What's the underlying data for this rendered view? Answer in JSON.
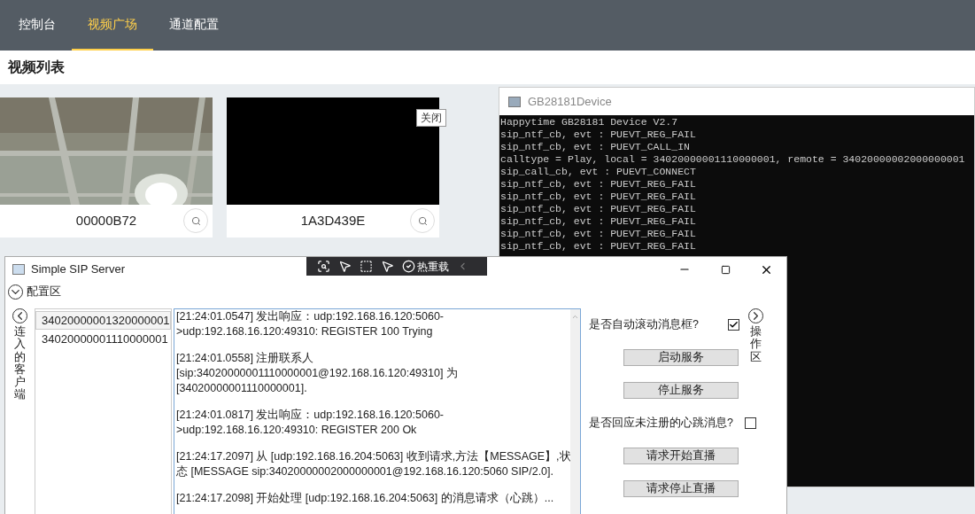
{
  "web_page": {
    "tabs": [
      {
        "label": "控制台",
        "selected": false
      },
      {
        "label": "视频广场",
        "selected": true
      },
      {
        "label": "通道配置",
        "selected": false
      }
    ],
    "section_title": "视频列表",
    "videos": [
      {
        "kind": "picture",
        "name": "00000B72"
      },
      {
        "kind": "blank",
        "name": "1A3D439E",
        "close_label": "关闭"
      }
    ]
  },
  "console_window": {
    "title": "GB28181Device",
    "lines": [
      "Happytime GB28181 Device V2.7",
      "sip_ntf_cb, evt : PUEVT_REG_FAIL",
      "sip_ntf_cb, evt : PUEVT_CALL_IN",
      "calltype = Play, local = 34020000001110000001, remote = 34020000002000000001",
      "sip_call_cb, evt : PUEVT_CONNECT",
      "sip_ntf_cb, evt : PUEVT_REG_FAIL",
      "sip_ntf_cb, evt : PUEVT_REG_FAIL",
      "sip_ntf_cb, evt : PUEVT_REG_FAIL",
      "sip_ntf_cb, evt : PUEVT_REG_FAIL",
      "sip_ntf_cb, evt : PUEVT_REG_FAIL",
      "sip_ntf_cb, evt : PUEVT_REG_FAIL"
    ]
  },
  "sip_window": {
    "title": "Simple SIP Server",
    "debug_toolbar": {
      "hot_reload_label": "热重载"
    },
    "config_section": "配置区",
    "clients_label": "连入的客户端",
    "operations_label": "操作区",
    "clients": [
      {
        "id": "34020000001320000001",
        "selected": true
      },
      {
        "id": "34020000001110000001",
        "selected": false
      }
    ],
    "log": [
      {
        "lines": [
          "[21:24:01.0547] 发出响应：udp:192.168.16.120:5060-",
          ">udp:192.168.16.120:49310: REGISTER 100 Trying"
        ]
      },
      {
        "lines": [
          "[21:24:01.0558] 注册联系人",
          "[sip:34020000001110000001@192.168.16.120:49310] 为",
          "[34020000001110000001]."
        ]
      },
      {
        "lines": [
          "[21:24:01.0817] 发出响应：udp:192.168.16.120:5060-",
          ">udp:192.168.16.120:49310: REGISTER 200 Ok"
        ]
      },
      {
        "lines": [
          "[21:24:17.2097] 从 [udp:192.168.16.204:5063] 收到请求,方法【MESSAGE】,状",
          "态 [MESSAGE sip:34020000002000000001@192.168.16.120:5060 SIP/2.0]."
        ]
      },
      {
        "lines": [
          "[21:24:17.2098] 开始处理 [udp:192.168.16.204:5063] 的消息请求（心跳）..."
        ]
      }
    ],
    "controls": [
      {
        "kind": "checkbox",
        "label": "是否自动滚动消息框?",
        "checked": true
      },
      {
        "kind": "button",
        "label": "启动服务"
      },
      {
        "kind": "button",
        "label": "停止服务"
      },
      {
        "kind": "checkbox",
        "label": "是否回应未注册的心跳消息?",
        "checked": false
      },
      {
        "kind": "button",
        "label": "请求开始直播"
      },
      {
        "kind": "button",
        "label": "请求停止直播"
      }
    ]
  }
}
